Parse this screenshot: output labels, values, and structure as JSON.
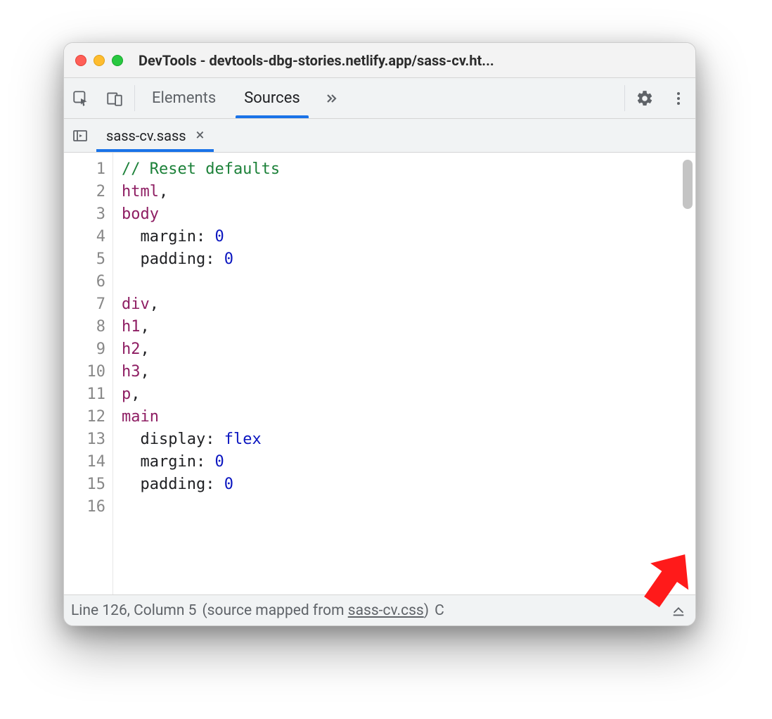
{
  "window": {
    "title": "DevTools - devtools-dbg-stories.netlify.app/sass-cv.ht..."
  },
  "toolbar": {
    "tabs": [
      {
        "label": "Elements",
        "active": false
      },
      {
        "label": "Sources",
        "active": true
      }
    ]
  },
  "file_tab": {
    "name": "sass-cv.sass"
  },
  "code_lines": [
    {
      "n": "1",
      "tokens": [
        {
          "cls": "tok-comment",
          "t": "// Reset defaults"
        }
      ]
    },
    {
      "n": "2",
      "tokens": [
        {
          "cls": "tok-selector",
          "t": "html"
        },
        {
          "cls": "tok-punct",
          "t": ","
        }
      ]
    },
    {
      "n": "3",
      "tokens": [
        {
          "cls": "tok-selector",
          "t": "body"
        }
      ]
    },
    {
      "n": "4",
      "tokens": [
        {
          "cls": "",
          "t": "  "
        },
        {
          "cls": "tok-property",
          "t": "margin"
        },
        {
          "cls": "tok-punct",
          "t": ": "
        },
        {
          "cls": "tok-value",
          "t": "0"
        }
      ]
    },
    {
      "n": "5",
      "tokens": [
        {
          "cls": "",
          "t": "  "
        },
        {
          "cls": "tok-property",
          "t": "padding"
        },
        {
          "cls": "tok-punct",
          "t": ": "
        },
        {
          "cls": "tok-value",
          "t": "0"
        }
      ]
    },
    {
      "n": "6",
      "tokens": []
    },
    {
      "n": "7",
      "tokens": [
        {
          "cls": "tok-selector",
          "t": "div"
        },
        {
          "cls": "tok-punct",
          "t": ","
        }
      ]
    },
    {
      "n": "8",
      "tokens": [
        {
          "cls": "tok-selector",
          "t": "h1"
        },
        {
          "cls": "tok-punct",
          "t": ","
        }
      ]
    },
    {
      "n": "9",
      "tokens": [
        {
          "cls": "tok-selector",
          "t": "h2"
        },
        {
          "cls": "tok-punct",
          "t": ","
        }
      ]
    },
    {
      "n": "10",
      "tokens": [
        {
          "cls": "tok-selector",
          "t": "h3"
        },
        {
          "cls": "tok-punct",
          "t": ","
        }
      ]
    },
    {
      "n": "11",
      "tokens": [
        {
          "cls": "tok-selector",
          "t": "p"
        },
        {
          "cls": "tok-punct",
          "t": ","
        }
      ]
    },
    {
      "n": "12",
      "tokens": [
        {
          "cls": "tok-selector",
          "t": "main"
        }
      ]
    },
    {
      "n": "13",
      "tokens": [
        {
          "cls": "",
          "t": "  "
        },
        {
          "cls": "tok-property",
          "t": "display"
        },
        {
          "cls": "tok-punct",
          "t": ": "
        },
        {
          "cls": "tok-value",
          "t": "flex"
        }
      ]
    },
    {
      "n": "14",
      "tokens": [
        {
          "cls": "",
          "t": "  "
        },
        {
          "cls": "tok-property",
          "t": "margin"
        },
        {
          "cls": "tok-punct",
          "t": ": "
        },
        {
          "cls": "tok-value",
          "t": "0"
        }
      ]
    },
    {
      "n": "15",
      "tokens": [
        {
          "cls": "",
          "t": "  "
        },
        {
          "cls": "tok-property",
          "t": "padding"
        },
        {
          "cls": "tok-punct",
          "t": ": "
        },
        {
          "cls": "tok-value",
          "t": "0"
        }
      ]
    },
    {
      "n": "16",
      "tokens": []
    }
  ],
  "status": {
    "cursor": "Line 126, Column 5",
    "mapped_prefix": "(source mapped from ",
    "mapped_file": "sass-cv.css",
    "mapped_suffix": ")",
    "truncated": "C"
  }
}
